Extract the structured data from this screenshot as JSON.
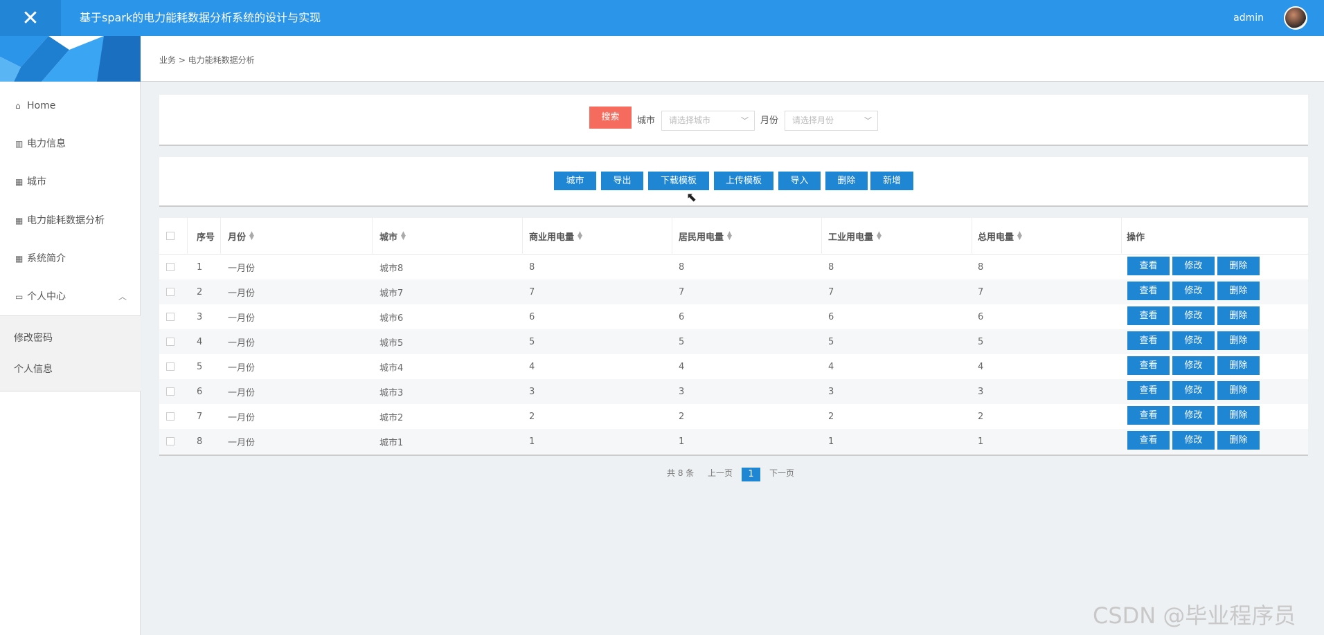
{
  "header": {
    "title": "基于spark的电力能耗数据分析系统的设计与实现",
    "user": "admin"
  },
  "sidebar": {
    "items": [
      {
        "label": "Home",
        "icon": "home-icon"
      },
      {
        "label": "电力信息",
        "icon": "bar-chart-icon"
      },
      {
        "label": "城市",
        "icon": "grid-icon"
      },
      {
        "label": "电力能耗数据分析",
        "icon": "grid-icon"
      },
      {
        "label": "系统简介",
        "icon": "grid-icon"
      },
      {
        "label": "个人中心",
        "icon": "card-icon"
      }
    ],
    "sub_items": [
      {
        "label": "修改密码"
      },
      {
        "label": "个人信息"
      }
    ]
  },
  "breadcrumb": "业务 > 电力能耗数据分析",
  "search": {
    "button": "搜索",
    "city_label": "城市",
    "city_placeholder": "请选择城市",
    "month_label": "月份",
    "month_placeholder": "请选择月份"
  },
  "toolbar": {
    "buttons": [
      "城市",
      "导出",
      "下载模板",
      "上传模板",
      "导入",
      "删除",
      "新增"
    ]
  },
  "table": {
    "columns": [
      "序号",
      "月份",
      "城市",
      "商业用电量",
      "居民用电量",
      "工业用电量",
      "总用电量",
      "操作"
    ],
    "rows": [
      [
        "1",
        "一月份",
        "城市8",
        "8",
        "8",
        "8",
        "8"
      ],
      [
        "2",
        "一月份",
        "城市7",
        "7",
        "7",
        "7",
        "7"
      ],
      [
        "3",
        "一月份",
        "城市6",
        "6",
        "6",
        "6",
        "6"
      ],
      [
        "4",
        "一月份",
        "城市5",
        "5",
        "5",
        "5",
        "5"
      ],
      [
        "5",
        "一月份",
        "城市4",
        "4",
        "4",
        "4",
        "4"
      ],
      [
        "6",
        "一月份",
        "城市3",
        "3",
        "3",
        "3",
        "3"
      ],
      [
        "7",
        "一月份",
        "城市2",
        "2",
        "2",
        "2",
        "2"
      ],
      [
        "8",
        "一月份",
        "城市1",
        "1",
        "1",
        "1",
        "1"
      ]
    ],
    "actions": [
      "查看",
      "修改",
      "删除"
    ]
  },
  "pagination": {
    "total": "共 8 条",
    "prev": "上一页",
    "current": "1",
    "next": "下一页"
  },
  "watermark": "CSDN @毕业程序员",
  "colors": {
    "header": "#2b95e9",
    "primary_button": "#1f86d3",
    "search_button": "#f56c5f"
  }
}
